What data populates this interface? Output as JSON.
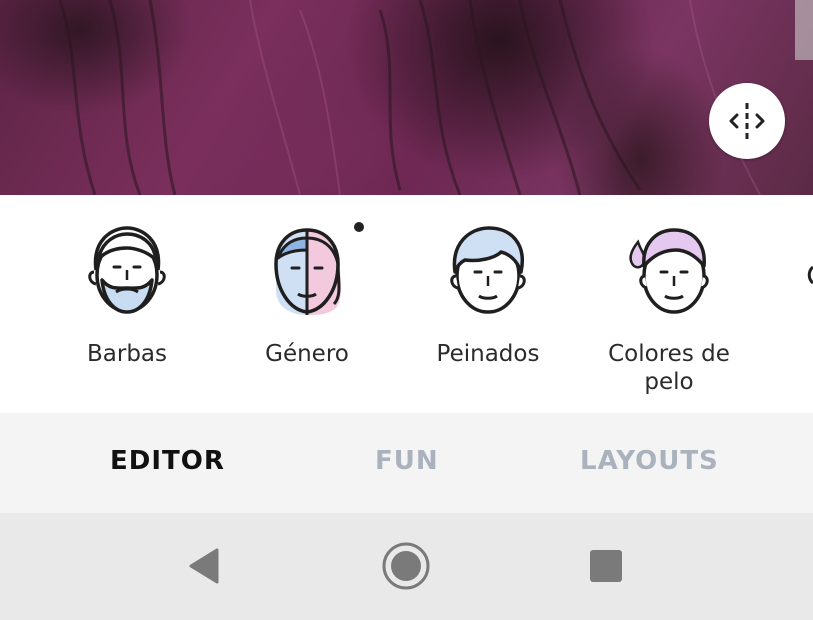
{
  "tools": [
    {
      "label": "Barbas",
      "icon": "beard-face-icon"
    },
    {
      "label": "Género",
      "icon": "gender-face-icon",
      "badge": true
    },
    {
      "label": "Peinados",
      "icon": "hairstyle-face-icon"
    },
    {
      "label": "Colores de pelo",
      "icon": "hair-color-face-icon"
    }
  ],
  "tabs": [
    {
      "label": "EDITOR",
      "active": true
    },
    {
      "label": "FUN",
      "active": false
    },
    {
      "label": "LAYOUTS",
      "active": false
    }
  ],
  "colors": {
    "tab_active": "#111111",
    "tab_inactive": "#a9b2bd",
    "accent_blue": "#cfe0f5",
    "accent_pink": "#f3c9dd",
    "accent_lilac": "#e4c8ef"
  },
  "icons": {
    "split_compare": "compare-split-icon",
    "nav_back": "back-triangle-icon",
    "nav_home": "home-circle-icon",
    "nav_recents": "recents-square-icon"
  }
}
